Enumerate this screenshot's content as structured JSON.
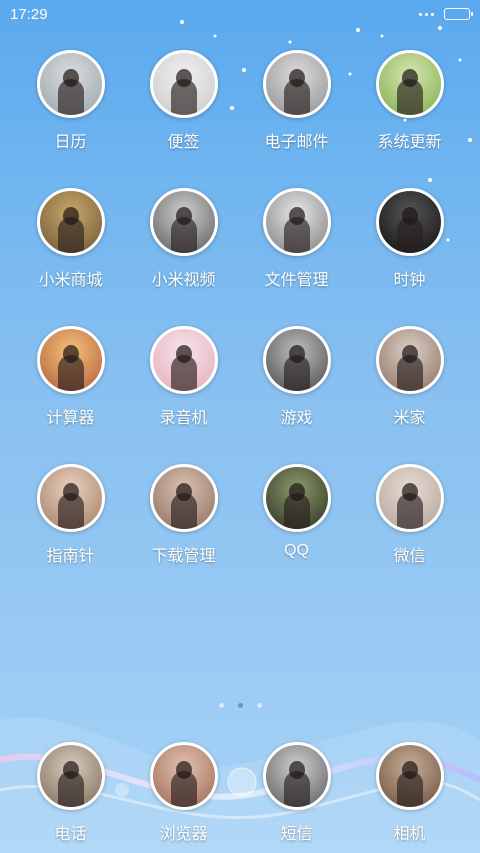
{
  "status_bar": {
    "time": "17:29",
    "battery_level": 0.9
  },
  "apps": [
    {
      "label": "日历",
      "icon": "calendar-photo-icon",
      "colors": [
        "#9aa3a8",
        "#d8dde0"
      ]
    },
    {
      "label": "便签",
      "icon": "notes-photo-icon",
      "colors": [
        "#c9c9c9",
        "#f0f0f0"
      ]
    },
    {
      "label": "电子邮件",
      "icon": "email-photo-icon",
      "colors": [
        "#8f8f8f",
        "#dcdcdc"
      ]
    },
    {
      "label": "系统更新",
      "icon": "system-update-photo-icon",
      "colors": [
        "#7cab4a",
        "#d7e7b0"
      ]
    },
    {
      "label": "小米商城",
      "icon": "mi-store-photo-icon",
      "colors": [
        "#6b5636",
        "#c9a86a"
      ]
    },
    {
      "label": "小米视频",
      "icon": "mi-video-photo-icon",
      "colors": [
        "#5a5a5a",
        "#cfcfcf"
      ]
    },
    {
      "label": "文件管理",
      "icon": "file-manager-photo-icon",
      "colors": [
        "#7d7d7d",
        "#e6e6e6"
      ]
    },
    {
      "label": "时钟",
      "icon": "clock-photo-icon",
      "colors": [
        "#111111",
        "#555555"
      ]
    },
    {
      "label": "计算器",
      "icon": "calculator-photo-icon",
      "colors": [
        "#b25a3a",
        "#f3c27a"
      ]
    },
    {
      "label": "录音机",
      "icon": "recorder-photo-icon",
      "colors": [
        "#e4a9b8",
        "#f7e4ea"
      ]
    },
    {
      "label": "游戏",
      "icon": "game-photo-icon",
      "colors": [
        "#4a4a4a",
        "#bdbdbd"
      ]
    },
    {
      "label": "米家",
      "icon": "mijia-photo-icon",
      "colors": [
        "#8a6f5c",
        "#dcd0c8"
      ]
    },
    {
      "label": "指南针",
      "icon": "compass-photo-icon",
      "colors": [
        "#a27b62",
        "#e9d2c0"
      ]
    },
    {
      "label": "下载管理",
      "icon": "download-manager-photo-icon",
      "colors": [
        "#8c6b5a",
        "#d9c3b5"
      ]
    },
    {
      "label": "QQ",
      "icon": "qq-photo-icon",
      "colors": [
        "#2a2f24",
        "#8c9a6a"
      ]
    },
    {
      "label": "微信",
      "icon": "wechat-photo-icon",
      "colors": [
        "#b0a198",
        "#e7dcd4"
      ]
    }
  ],
  "pager": {
    "pages": 3,
    "active": 1
  },
  "dock": [
    {
      "label": "电话",
      "icon": "phone-photo-icon",
      "colors": [
        "#7a6a58",
        "#d8cbbd"
      ]
    },
    {
      "label": "浏览器",
      "icon": "browser-photo-icon",
      "colors": [
        "#9b6650",
        "#e3c2b3"
      ]
    },
    {
      "label": "短信",
      "icon": "messages-photo-icon",
      "colors": [
        "#5a5a5a",
        "#cfcfcf"
      ]
    },
    {
      "label": "相机",
      "icon": "camera-photo-icon",
      "colors": [
        "#6b4f3c",
        "#c7ad96"
      ]
    }
  ]
}
